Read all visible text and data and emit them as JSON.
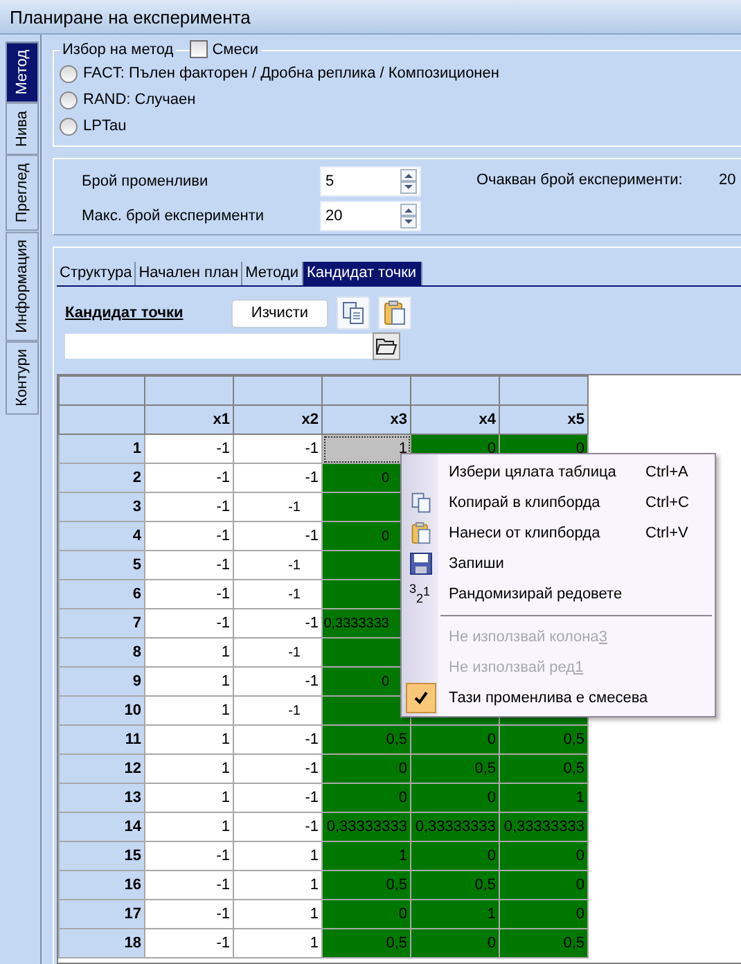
{
  "window": {
    "title": "Планиране на експеримента"
  },
  "side_tabs": [
    {
      "label": "Метод",
      "selected": true
    },
    {
      "label": "Нива",
      "selected": false
    },
    {
      "label": "Преглед",
      "selected": false
    },
    {
      "label": "Информация",
      "selected": false
    },
    {
      "label": "Контури",
      "selected": false
    }
  ],
  "method_group": {
    "title": "Избор на метод",
    "mixture": {
      "label": "Смеси",
      "checked": false
    },
    "options": [
      {
        "label": "FACT: Пълен факторен / Дробна реплика / Композиционен",
        "selected": false
      },
      {
        "label": "RAND: Случаен",
        "selected": false
      },
      {
        "label": "LPTau",
        "selected": false
      }
    ]
  },
  "parameters": [
    {
      "label": "Брой променливи",
      "value": "5"
    },
    {
      "label": "Макс. брой експерименти",
      "value": "20"
    }
  ],
  "expected": {
    "label": "Очакван брой експерименти:",
    "value": "20"
  },
  "inner_tabs": [
    {
      "label": "Структура",
      "selected": false
    },
    {
      "label": "Начален план",
      "selected": false
    },
    {
      "label": "Методи",
      "selected": false
    },
    {
      "label": "Кандидат точки",
      "selected": true
    }
  ],
  "candidates": {
    "title": "Кандидат точки",
    "clear_button": "Изчисти"
  },
  "table": {
    "columns": [
      {
        "name": "x1",
        "mixture": false,
        "selected": false
      },
      {
        "name": "x2",
        "mixture": false,
        "selected": false
      },
      {
        "name": "x3",
        "mixture": true,
        "selected": true
      },
      {
        "name": "x4",
        "mixture": true,
        "selected": false
      },
      {
        "name": "x5",
        "mixture": true,
        "selected": false
      }
    ],
    "rows": [
      {
        "label": "1",
        "selected": true,
        "cells": [
          "-1",
          "-1",
          "1",
          "0",
          "0"
        ]
      },
      {
        "label": "2",
        "selected": false,
        "cells": [
          "-1",
          "-1",
          "0",
          null,
          null
        ]
      },
      {
        "label": "3",
        "selected": false,
        "cells": [
          "-1",
          "-1",
          null,
          null,
          null
        ]
      },
      {
        "label": "4",
        "selected": false,
        "cells": [
          "-1",
          "-1",
          "0",
          null,
          null
        ]
      },
      {
        "label": "5",
        "selected": false,
        "cells": [
          "-1",
          "-1",
          null,
          null,
          null
        ]
      },
      {
        "label": "6",
        "selected": false,
        "cells": [
          "-1",
          "-1",
          null,
          null,
          null
        ]
      },
      {
        "label": "7",
        "selected": false,
        "cells": [
          "-1",
          "-1",
          "0,3333333",
          null,
          null
        ]
      },
      {
        "label": "8",
        "selected": false,
        "cells": [
          "1",
          "-1",
          null,
          null,
          null
        ]
      },
      {
        "label": "9",
        "selected": false,
        "cells": [
          "1",
          "-1",
          "0",
          null,
          null
        ]
      },
      {
        "label": "10",
        "selected": false,
        "cells": [
          "1",
          "-1",
          null,
          null,
          null
        ]
      },
      {
        "label": "11",
        "selected": false,
        "cells": [
          "1",
          "-1",
          "0,5",
          "0",
          "0,5"
        ]
      },
      {
        "label": "12",
        "selected": false,
        "cells": [
          "1",
          "-1",
          "0",
          "0,5",
          "0,5"
        ]
      },
      {
        "label": "13",
        "selected": false,
        "cells": [
          "1",
          "-1",
          "0",
          "0",
          "1"
        ]
      },
      {
        "label": "14",
        "selected": false,
        "cells": [
          "1",
          "-1",
          "0,33333333",
          "0,33333333",
          "0,33333333"
        ]
      },
      {
        "label": "15",
        "selected": false,
        "cells": [
          "-1",
          "1",
          "1",
          "0",
          "0"
        ]
      },
      {
        "label": "16",
        "selected": false,
        "cells": [
          "-1",
          "1",
          "0,5",
          "0,5",
          "0"
        ]
      },
      {
        "label": "17",
        "selected": false,
        "cells": [
          "-1",
          "1",
          "0",
          "1",
          "0"
        ]
      },
      {
        "label": "18",
        "selected": false,
        "cells": [
          "-1",
          "1",
          "0,5",
          "0",
          "0,5"
        ]
      }
    ]
  },
  "context_menu": {
    "items": [
      {
        "kind": "plain",
        "label": "Избери цялата таблица",
        "shortcut": "Ctrl+A",
        "disabled": false
      },
      {
        "kind": "copy",
        "label": "Копирай в клипборда",
        "shortcut": "Ctrl+C",
        "disabled": false
      },
      {
        "kind": "paste",
        "label": "Нанеси от клипборда",
        "shortcut": "Ctrl+V",
        "disabled": false
      },
      {
        "kind": "save",
        "label": "Запиши",
        "disabled": false
      },
      {
        "kind": "sort",
        "icon_text": "321",
        "label": "Рандомизирай редовете",
        "disabled": false
      },
      {
        "kind": "separator"
      },
      {
        "kind": "plain",
        "label": "Не използвай колона",
        "accel": "3",
        "disabled": true
      },
      {
        "kind": "plain",
        "label": "Не използвай ред",
        "accel": "1",
        "disabled": true
      },
      {
        "kind": "toggle",
        "label": "Тази променлива е смесева",
        "disabled": false,
        "checked": true
      }
    ]
  }
}
